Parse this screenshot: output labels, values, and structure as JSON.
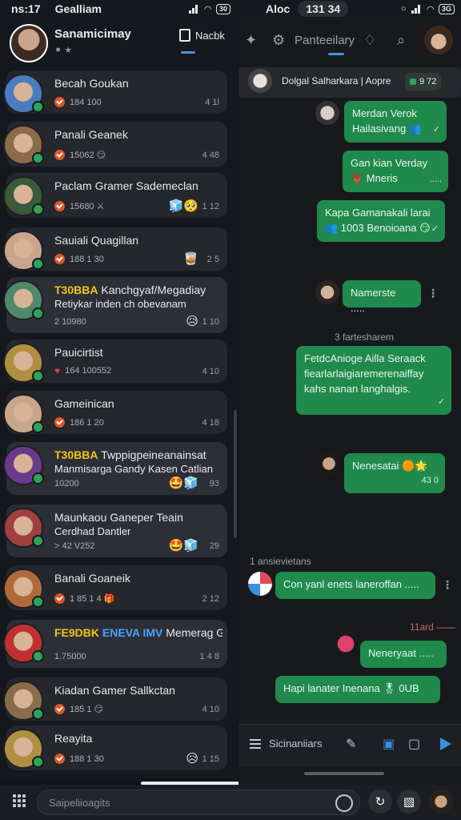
{
  "status_left": {
    "time": "ns:17",
    "carrier": "Gealliam",
    "battery": "30"
  },
  "status_right": {
    "carrier": "Aloc",
    "time": "131 34",
    "battery": "3G"
  },
  "profile": {
    "name": "Sanamicimay",
    "sub": "⚫ ★"
  },
  "notes_tab": "Nacbk",
  "right_title": "Panteeilary",
  "chats": [
    {
      "name": "Becah Goukan",
      "sub": "184 100",
      "time": "4 1l",
      "badge": "check"
    },
    {
      "name": "Panali Geanek",
      "sub": "15062 😏",
      "time": "4 48",
      "badge": "check"
    },
    {
      "name": "Paclam Gramer Sademeclan",
      "sub": "15680 ⚔",
      "time": "1 12",
      "badge": "check",
      "emoji": "🧊🥺"
    },
    {
      "name": "Sauiali Quagillan",
      "sub": "188 1 30",
      "time": "2 5",
      "badge": "check",
      "emoji": "🥃"
    },
    {
      "tag": "T30BBA",
      "name": "Kanchgyaf/Megadiay",
      "line2": "Retiykar inden ch obevanam",
      "sub": "2 10980",
      "time": "1 10",
      "emoji": "😥"
    },
    {
      "name": "Pauicirtist",
      "sub": "164 100552",
      "time": "4 10",
      "badge": "heart"
    },
    {
      "name": "Gameinican",
      "sub": "186 1 20",
      "time": "4 18",
      "badge": "check"
    },
    {
      "tag": "T30BBA",
      "name": "Twppigpeineanainsat",
      "line2": "Manmisarga Gandy Kasen Catlian",
      "sub": "10200",
      "time": "93",
      "emoji": "🤩🧊"
    },
    {
      "name": "Maunkaou Ganeper Teain",
      "line2": "Cerdhad Dantler",
      "sub": "> 42 V252",
      "time": "29",
      "emoji": "🤩🧊"
    },
    {
      "name": "Banali Goaneik",
      "sub": "1 85 1 4 🎁",
      "time": "2 12",
      "badge": "check"
    },
    {
      "tag": "FE9DBK",
      "tag2": "ENEVA IMV",
      "name": "Memerag Galanier 🎞 Mal",
      "sub": "1.75000",
      "time": "1 4 8"
    },
    {
      "name": "Kiadan Gamer Sallkctan",
      "sub": "185 1 😏",
      "time": "4 10",
      "badge": "check"
    },
    {
      "name": "Reayita",
      "sub": "188 1 30",
      "time": "1 15",
      "badge": "check",
      "emoji": "😥"
    }
  ],
  "search_placeholder": "Saipeliioagits",
  "chat_header": {
    "name": "Dolgal Salharkara | Aopre",
    "status": "9 72"
  },
  "messages": [
    {
      "text": "Merdan Verok Hailasivang 👥",
      "tick": "✓"
    },
    {
      "text": "Gan kian Verday 🦞 Mneris",
      "tick": "....."
    },
    {
      "text": "Kapa Gamanakali larai 👥 1003 Benoioana 😏",
      "tick": "✓"
    },
    {
      "text": "Namerste .....",
      "tick": ""
    },
    {
      "system": "3 fartesharem"
    },
    {
      "text": "FetdcAnioge Ailla Seraack fiearlarlaigiaremerenaiffay kahs nanan langhalgis.",
      "tick": "✓"
    },
    {
      "text": "Nenesatai 🟠🌟",
      "tick": "43 0"
    },
    {
      "system": "1 ansievietans"
    },
    {
      "text": "Con yanl enets laneroffan .....",
      "tick": ""
    },
    {
      "system": "11ard ——"
    },
    {
      "text": "Neneryaat .....",
      "tick": ""
    },
    {
      "text": "Hapi lanater Inenana 🎖 0UB",
      "tick": ""
    }
  ],
  "composer": {
    "placeholder": "Sicinaniiars"
  }
}
